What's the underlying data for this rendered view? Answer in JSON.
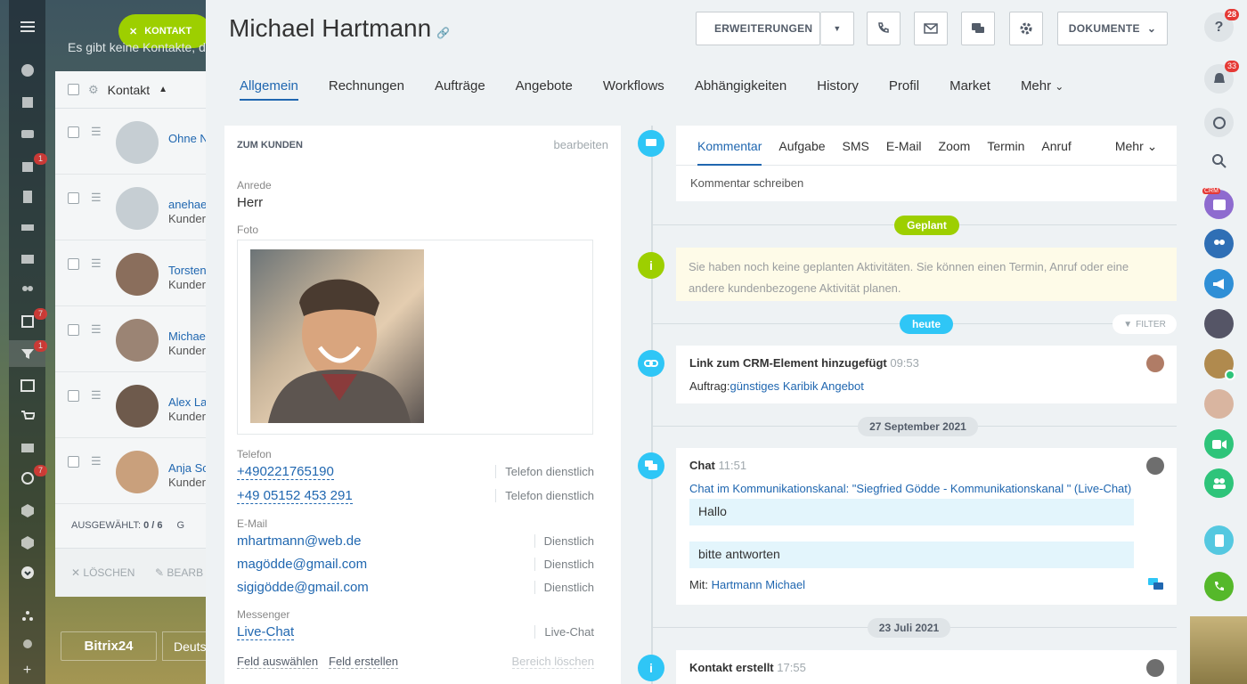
{
  "background": {
    "kontakt_button": "KONTAKT",
    "hint_text": "Es gibt keine Kontakte, d",
    "column_header": "Kontakt",
    "rows": [
      {
        "name": "Ohne N",
        "sub": ""
      },
      {
        "name": "anehae",
        "sub": "Kunder"
      },
      {
        "name": "Torsten",
        "sub": "Kunder"
      },
      {
        "name": "Michae",
        "sub": "Kunder"
      },
      {
        "name": "Alex La",
        "sub": "Kunder"
      },
      {
        "name": "Anja Sc",
        "sub": "Kunder"
      }
    ],
    "selected_label": "AUSGEWÄHLT:",
    "selected_count": "0 / 6",
    "selected_suffix": "G",
    "delete_label": "LÖSCHEN",
    "edit_label": "BEARB",
    "logo": "Bitrix24",
    "lang_btn": "Deuts",
    "nav_badges": [
      "1",
      "7",
      "1",
      "7"
    ]
  },
  "header": {
    "title": "Michael  Hartmann",
    "btn_extensions": "ERWEITERUNGEN",
    "btn_documents": "DOKUMENTE"
  },
  "tabs": [
    "Allgemein",
    "Rechnungen",
    "Aufträge",
    "Angebote",
    "Workflows",
    "Abhängigkeiten",
    "History",
    "Profil",
    "Market",
    "Mehr"
  ],
  "left_card": {
    "section_title": "ZUM KUNDEN",
    "edit_link": "bearbeiten",
    "salutation_label": "Anrede",
    "salutation_value": "Herr",
    "photo_label": "Foto",
    "phone_label": "Telefon",
    "phones": [
      {
        "number": "+490221765190",
        "type": "Telefon dienstlich"
      },
      {
        "number": "+49 05152 453 291",
        "type": "Telefon dienstlich"
      }
    ],
    "email_label": "E-Mail",
    "emails": [
      {
        "address": "mhartmann@web.de",
        "type": "Dienstlich"
      },
      {
        "address": "magödde@gmail.com",
        "type": "Dienstlich"
      },
      {
        "address": "sigigödde@gmail.com",
        "type": "Dienstlich"
      }
    ],
    "messenger_label": "Messenger",
    "messenger_value": "Live-Chat",
    "messenger_type": "Live-Chat",
    "footer_select": "Feld auswählen",
    "footer_create": "Feld erstellen",
    "footer_delete": "Bereich löschen"
  },
  "composer": {
    "tabs": [
      "Kommentar",
      "Aufgabe",
      "SMS",
      "E-Mail",
      "Zoom",
      "Termin",
      "Anruf"
    ],
    "more": "Mehr",
    "placeholder": "Kommentar schreiben"
  },
  "timeline": {
    "planned_pill": "Geplant",
    "planned_notice": "Sie haben noch keine geplanten Aktivitäten. Sie können einen Termin, Anruf oder eine andere kundenbezogene Aktivität planen.",
    "today_pill": "heute",
    "filter_label": "FILTER",
    "link_item": {
      "title": "Link zum CRM-Element hinzugefügt",
      "time": "09:53",
      "prefix": "Auftrag:",
      "link1": "günstiges",
      "link2": "Karibik Angebot"
    },
    "date1": "27 September 2021",
    "chat_item": {
      "title": "Chat",
      "time": "11:51",
      "channel": "Chat im Kommunikationskanal: \"Siegfried Gödde - Kommunikationskanal \" (Live-Chat)",
      "msg1": "Hallo",
      "msg2": "bitte antworten",
      "with_label": "Mit:",
      "with_name": "Hartmann Michael"
    },
    "date2": "23 Juli 2021",
    "created_item": {
      "title": "Kontakt erstellt",
      "time": "17:55"
    }
  },
  "rightbar": {
    "badge_help": "28",
    "badge_notify": "33",
    "crm_label": "CRM"
  },
  "colors": {
    "accent": "#2067b0",
    "green": "#9dcf00",
    "cyan": "#2fc6f6"
  }
}
